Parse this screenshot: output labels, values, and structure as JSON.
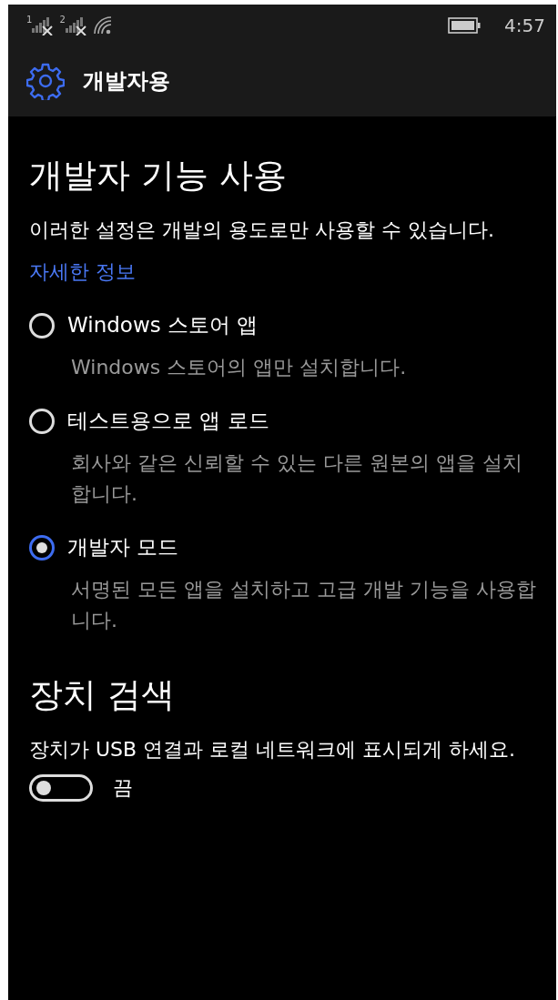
{
  "status_bar": {
    "sim_1": "1",
    "sim_2": "2",
    "time": "4:57"
  },
  "header": {
    "title": "개발자용"
  },
  "sections": [
    {
      "title": "개발자 기능 사용",
      "description": "이러한 설정은 개발의 용도로만 사용할 수 있습니다.",
      "link": "자세한 정보",
      "options": [
        {
          "label": "Windows 스토어 앱",
          "description": "Windows 스토어의 앱만 설치합니다.",
          "selected": false
        },
        {
          "label": "테스트용으로 앱 로드",
          "description": "회사와 같은 신뢰할 수 있는 다른 원본의 앱을 설치합니다.",
          "selected": false
        },
        {
          "label": "개발자 모드",
          "description": "서명된 모든 앱을 설치하고 고급 개발 기능을 사용합니다.",
          "selected": true
        }
      ]
    },
    {
      "title": "장치 검색",
      "description": "장치가 USB 연결과 로컬 네트워크에 표시되게 하세요.",
      "toggle": {
        "on": false,
        "label": "끔"
      }
    }
  ]
}
